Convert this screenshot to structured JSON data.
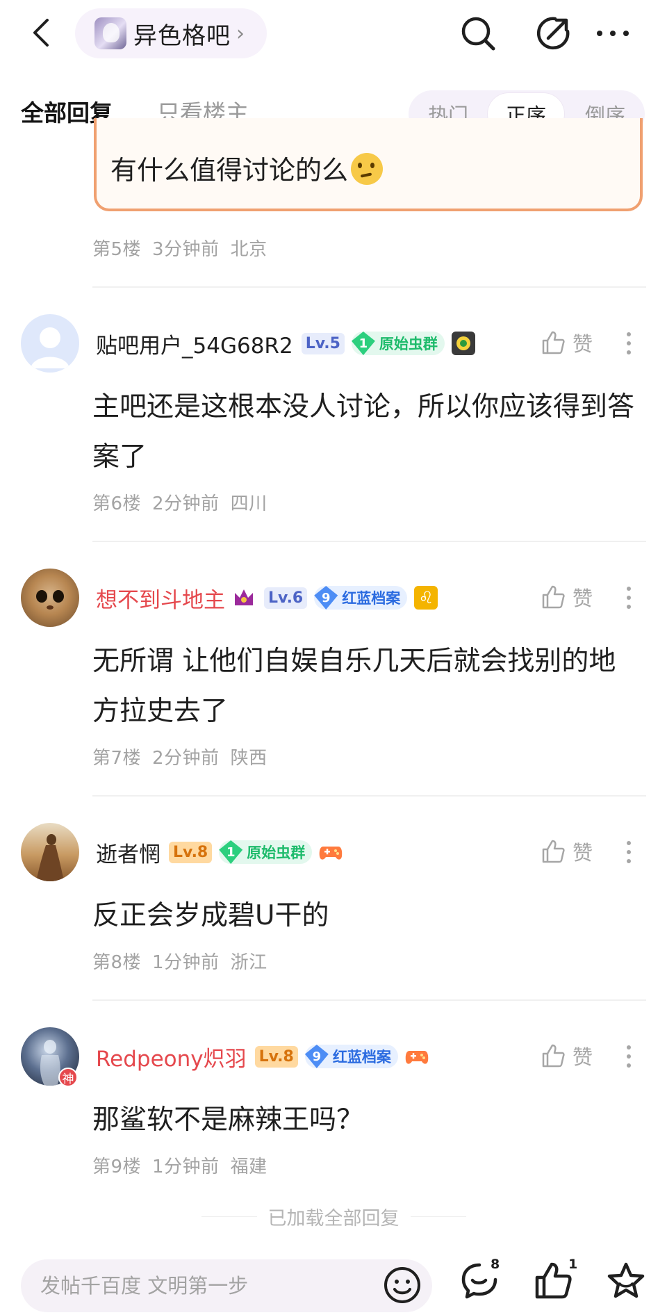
{
  "topbar": {
    "forum_name": "异色格吧",
    "forum_chevron": "›"
  },
  "tabs": {
    "all_replies": "全部回复",
    "only_op": "只看楼主",
    "sort_hot": "热门",
    "sort_asc": "正序",
    "sort_desc": "倒序"
  },
  "quoted": {
    "text": "有什么值得讨论的么"
  },
  "post5_meta": {
    "floor": "第5楼",
    "time": "3分钟前",
    "location": "北京"
  },
  "posts": [
    {
      "username": "贴吧用户_54G68R2",
      "level": "Lv.5",
      "badge_num": "1",
      "badge_text": "原始虫群",
      "content": "主吧还是这根本没人讨论，所以你应该得到答案了",
      "floor": "第6楼",
      "time": "2分钟前",
      "location": "四川",
      "like": "赞"
    },
    {
      "username": "想不到斗地主",
      "level": "Lv.6",
      "badge_num": "9",
      "badge_text": "红蓝档案",
      "content": "无所谓 让他们自娱自乐几天后就会找别的地方拉史去了",
      "floor": "第7楼",
      "time": "2分钟前",
      "location": "陕西",
      "like": "赞"
    },
    {
      "username": "逝者惘",
      "level": "Lv.8",
      "badge_num": "1",
      "badge_text": "原始虫群",
      "content": "反正会岁成碧U干的",
      "floor": "第8楼",
      "time": "1分钟前",
      "location": "浙江",
      "like": "赞"
    },
    {
      "username": "Redpeony炽羽",
      "level": "Lv.8",
      "badge_num": "9",
      "badge_text": "红蓝档案",
      "avatar_tag": "神",
      "content": "那鲨软不是麻辣王吗？",
      "floor": "第9楼",
      "time": "1分钟前",
      "location": "福建",
      "like": "赞"
    }
  ],
  "loaded_all": "已加载全部回复",
  "bottom": {
    "input_placeholder": "发帖千百度 文明第一步",
    "comment_count": "8",
    "like_count": "1"
  },
  "colors": {
    "accent_red": "#e5484d",
    "green_badge": "#1dbb6b",
    "blue_badge": "#2b6be0",
    "quote_border": "#f0a070"
  }
}
